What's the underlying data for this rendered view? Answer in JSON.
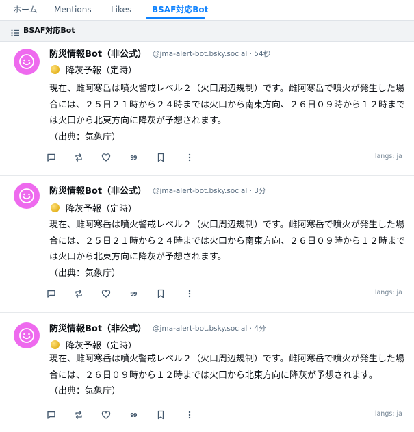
{
  "tabs": [
    {
      "label": "ホーム"
    },
    {
      "label": "Mentions"
    },
    {
      "label": "Likes"
    },
    {
      "label": "BSAF対応Bot",
      "active": true
    }
  ],
  "feed": {
    "title": "BSAF対応Bot",
    "icon": "list-icon"
  },
  "colors": {
    "accent": "#1083fe",
    "avatar": "#ee6aee",
    "text": "#0b0f14",
    "muted": "#5a6d80"
  },
  "posts": [
    {
      "author": "防災情報Bot（非公式）",
      "handle": "@jma-alert-bot.bsky.social",
      "time": "· 54秒",
      "heading": "降灰予報（定時）",
      "body": "現在、雌阿寒岳は噴火警戒レベル２（火口周辺規制）です。雌阿寒岳で噴火が発生した場合には、２５日２１時から２４時までは火口から南東方向、２６日０９時から１２時までは火口から北東方向に降灰が予想されます。\n（出典：気象庁）",
      "langs": "langs: ja",
      "quote_label": "99"
    },
    {
      "author": "防災情報Bot（非公式）",
      "handle": "@jma-alert-bot.bsky.social",
      "time": "· 3分",
      "heading": "降灰予報（定時）",
      "body": "現在、雌阿寒岳は噴火警戒レベル２（火口周辺規制）です。雌阿寒岳で噴火が発生した場合には、２５日２１時から２４時までは火口から南東方向、２６日０９時から１２時までは火口から北東方向に降灰が予想されます。\n（出典：気象庁）",
      "langs": "langs: ja",
      "quote_label": "99"
    },
    {
      "author": "防災情報Bot（非公式）",
      "handle": "@jma-alert-bot.bsky.social",
      "time": "· 4分",
      "heading": "降灰予報（定時）",
      "body": "現在、雌阿寒岳は噴火警戒レベル２（火口周辺規制）です。雌阿寒岳で噴火が発生した場合には、２６日０９時から１２時までは火口から北東方向に降灰が予想されます。\n（出典：気象庁）",
      "langs": "langs: ja",
      "quote_label": "99"
    }
  ]
}
